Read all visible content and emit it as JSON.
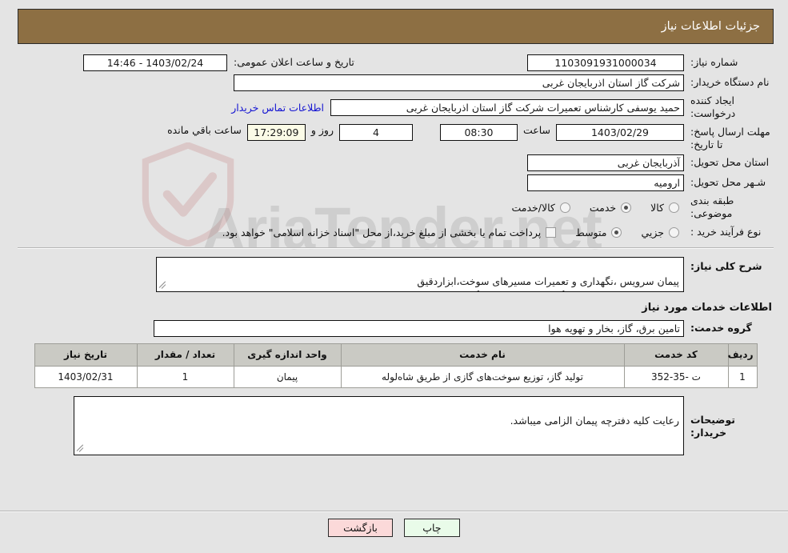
{
  "header": {
    "title": "جزئیات اطلاعات نیاز"
  },
  "form": {
    "need_number_label": "شماره نیاز:",
    "need_number_value": "1103091931000034",
    "announce_datetime_label": "تاریخ و ساعت اعلان عمومی:",
    "announce_datetime_value": "1403/02/24 - 14:46",
    "buyer_org_label": "نام دستگاه خریدار:",
    "buyer_org_value": "شرکت گاز استان اذربایجان غربی",
    "creator_label": "ایجاد کننده درخواست:",
    "creator_value": "حمید یوسفی کارشناس تعمیرات شرکت گاز استان اذربایجان غربی",
    "contact_link": "اطلاعات تماس خریدار",
    "deadline_label": "مهلت ارسال پاسخ: تا تاریخ:",
    "deadline_date": "1403/02/29",
    "time_label": "ساعت",
    "time_value": "08:30",
    "days_value": "4",
    "days_label": "روز و",
    "countdown_value": "17:29:09",
    "countdown_label": "ساعت باقي مانده",
    "province_label": "استان محل تحویل:",
    "province_value": "آذربایجان غربی",
    "city_label": "شـهر محل تحویل:",
    "city_value": "ارومیه",
    "category_label": "طبقه بندی موضوعی:",
    "category_options": [
      {
        "label": "کالا",
        "selected": false
      },
      {
        "label": "خدمت",
        "selected": true
      },
      {
        "label": "کالا/خدمت",
        "selected": false
      }
    ],
    "process_label": "نوع فرآیند خرید :",
    "process_options": [
      {
        "label": "جزيي",
        "selected": false
      },
      {
        "label": "متوسط",
        "selected": true
      }
    ],
    "treasury_checkbox_label": "پرداخت تمام یا بخشی از مبلغ خرید،از محل \"اسناد خزانه اسلامی\" خواهد بود.",
    "treasury_checked": false,
    "general_desc_label": "شرح کلی نیاز:",
    "general_desc_value": "پیمان سرویس ،نگهداری و تعمیرات مسیرهای سوخت،ابزاردقیق\nهیتر و سیستم ادورانت ایستگاه های تقلیل فشار گاز",
    "services_section_title": "اطلاعات خدمات مورد نیاز",
    "service_group_label": "گروه خدمت:",
    "service_group_value": "تامین برق، گاز، بخار و تهویه هوا",
    "buyer_notes_label": "توضیحات خریدار:",
    "buyer_notes_value": "رعایت کلیه دفترچه پیمان الزامی میباشد."
  },
  "table": {
    "columns": [
      "ردیف",
      "کد خدمت",
      "نام خدمت",
      "واحد اندازه گیری",
      "تعداد / مقدار",
      "تاریخ نیاز"
    ],
    "rows": [
      {
        "index": "1",
        "code": "ت -35-352",
        "name": "تولید گاز، توزیع سوخت‌های گازی از طریق شاه‌لوله",
        "unit": "پیمان",
        "qty": "1",
        "date": "1403/02/31"
      }
    ]
  },
  "buttons": {
    "print": "چاپ",
    "back": "بازگشت"
  },
  "watermark": {
    "text": "AriaTender.net"
  },
  "colors": {
    "header_brown": "#8d6f43",
    "link_blue": "#1414d2",
    "countdown_bg": "#fbfbe7",
    "table_header_bg": "#cacac4",
    "print_btn_bg": "#e9fbe9",
    "back_btn_bg": "#fbd9d9",
    "page_bg": "#e4e4e4"
  }
}
